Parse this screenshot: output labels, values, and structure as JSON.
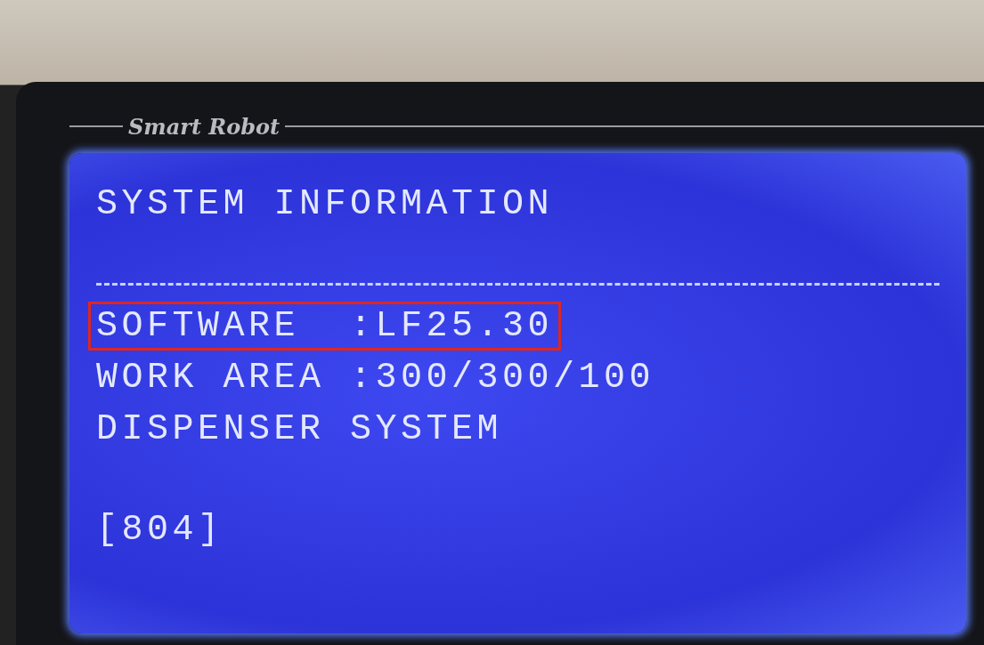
{
  "device_label": "Smart Robot",
  "screen": {
    "title": "SYSTEM INFORMATION",
    "lines": [
      {
        "kind": "field",
        "label": "SOFTWARE",
        "value": ":LF25.30",
        "highlighted": true
      },
      {
        "kind": "field",
        "label": "WORK AREA",
        "value": ":300/300/100",
        "highlighted": false
      },
      {
        "kind": "text",
        "text": "DISPENSER SYSTEM"
      }
    ],
    "code": "[804]"
  }
}
